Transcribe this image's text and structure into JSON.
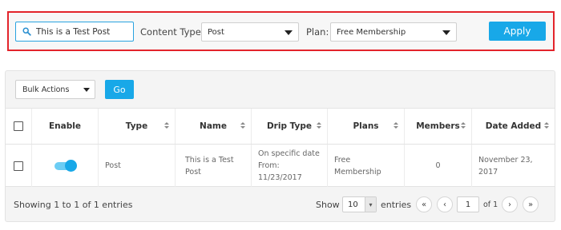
{
  "filters": {
    "search_value": "This is a Test Post",
    "content_type_label": "Content Type:",
    "content_type_value": "Post",
    "plan_label": "Plan:",
    "plan_value": "Free Membership",
    "apply_label": "Apply",
    "accent_border_color": "#e3242b"
  },
  "toolbar": {
    "bulk_actions_value": "Bulk Actions",
    "go_label": "Go"
  },
  "table": {
    "columns": [
      "Enable",
      "Type",
      "Name",
      "Drip Type",
      "Plans",
      "Members",
      "Date Added"
    ],
    "rows": [
      {
        "enabled": true,
        "type": "Post",
        "name": "This is a Test Post",
        "drip_type": "On specific date From: 11/23/2017",
        "plans": "Free Membership",
        "members": "0",
        "date_added": "November 23, 2017"
      }
    ]
  },
  "footer": {
    "info": "Showing 1 to 1 of 1 entries",
    "show_label": "Show",
    "page_size": "10",
    "entries_label": "entries",
    "first_label": "«",
    "prev_label": "‹",
    "current_page": "1",
    "of_label": "of 1",
    "next_label": "›",
    "last_label": "»"
  },
  "colors": {
    "primary": "#18a8e8",
    "toggle_track": "#6ccdf4"
  }
}
